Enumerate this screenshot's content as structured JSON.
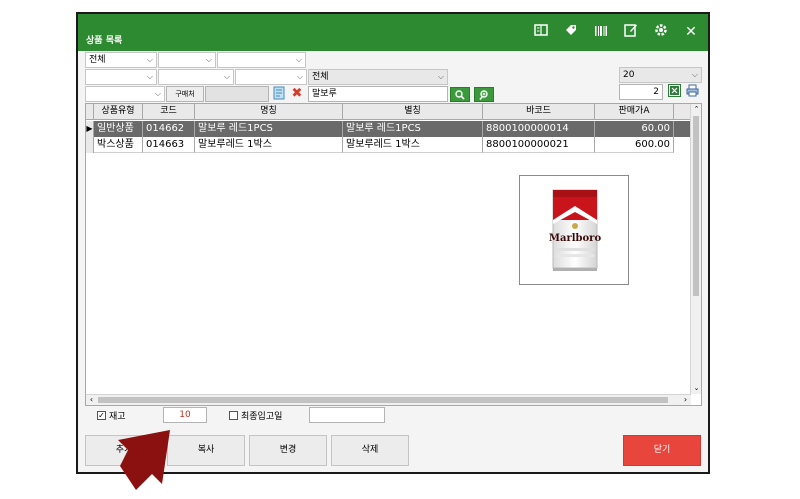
{
  "window": {
    "title": "상품 목록",
    "toolbar_icons": [
      "book-icon",
      "tag-icon",
      "barcode-icon",
      "edit-icon",
      "gear-icon",
      "close-icon"
    ],
    "close_glyph": "✕"
  },
  "filters": {
    "row1": {
      "combo1": "전체",
      "combo2": "",
      "combo3": ""
    },
    "row2": {
      "combo1": "",
      "combo2": "",
      "combo3": "",
      "combo4": "전체",
      "page_size": "20"
    },
    "row3": {
      "combo1": "",
      "buyer_button": "구매처",
      "buyer_field": "",
      "search_value": "말보루",
      "page_number": "2"
    }
  },
  "table": {
    "columns": [
      "상품유형",
      "코드",
      "명칭",
      "별칭",
      "바코드",
      "판매가A"
    ],
    "rows": [
      {
        "type": "일반상품",
        "code": "014662",
        "name": "말보루 레드1PCS",
        "alias": "말보루 레드1PCS",
        "barcode": "8800100000014",
        "price": "60.00",
        "selected": true
      },
      {
        "type": "박스상품",
        "code": "014663",
        "name": "말보루레드 1박스",
        "alias": "말보루레드 1박스",
        "barcode": "8800100000021",
        "price": "600.00",
        "selected": false
      }
    ],
    "preview_brand": "Marlboro"
  },
  "bottom_options": {
    "stock_checked": true,
    "stock_label": "재고",
    "stock_value": "10",
    "last_in_checked": false,
    "last_in_label": "최종입고일",
    "last_in_value": ""
  },
  "buttons": {
    "new_label": "추가",
    "copy_label": "복사",
    "change_label": "변경",
    "delete_label": "삭제",
    "close_label": "닫기"
  },
  "colors": {
    "titlebar": "#2e8a30",
    "selected_row": "#6a6a6a",
    "close_button": "#e8453c",
    "arrow": "#8b1010"
  }
}
